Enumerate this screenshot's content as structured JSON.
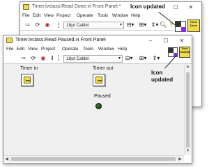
{
  "back_window": {
    "title": "Timer.lvclass:Read Done.vi Front Panel *",
    "menu": [
      "File",
      "Edit",
      "View",
      "Project",
      "Operate",
      "Tools",
      "Window",
      "Help"
    ],
    "font_selector": "18pt Calibri",
    "icon_text": "Timer\nDone"
  },
  "front_window": {
    "title": "Timer.lvclass:Read Paused.vi Front Panel",
    "menu": [
      "File",
      "Edit",
      "View",
      "Project",
      "Operate",
      "Tools",
      "Window",
      "Help"
    ],
    "font_selector": "18pt Calibri",
    "icon_text": "Timer\nPAUSED",
    "controls": {
      "timer_in": "Timer in",
      "timer_out": "Timer out",
      "paused": "Paused"
    }
  },
  "annotations": {
    "top": "Icon updated",
    "side_line1": "Icon",
    "side_line2": "updated"
  },
  "window_buttons": {
    "minimize": "–",
    "maximize": "☐",
    "close": "✕"
  },
  "toolbar_glyphs": {
    "run": "⇨",
    "run_continuous": "⟳",
    "abort": "◉",
    "pause": "‖",
    "help": "?",
    "dropdown": "▾"
  },
  "colors": {
    "accent_yellow": "#f0dc4a",
    "led_off": "#0c2a0c"
  }
}
